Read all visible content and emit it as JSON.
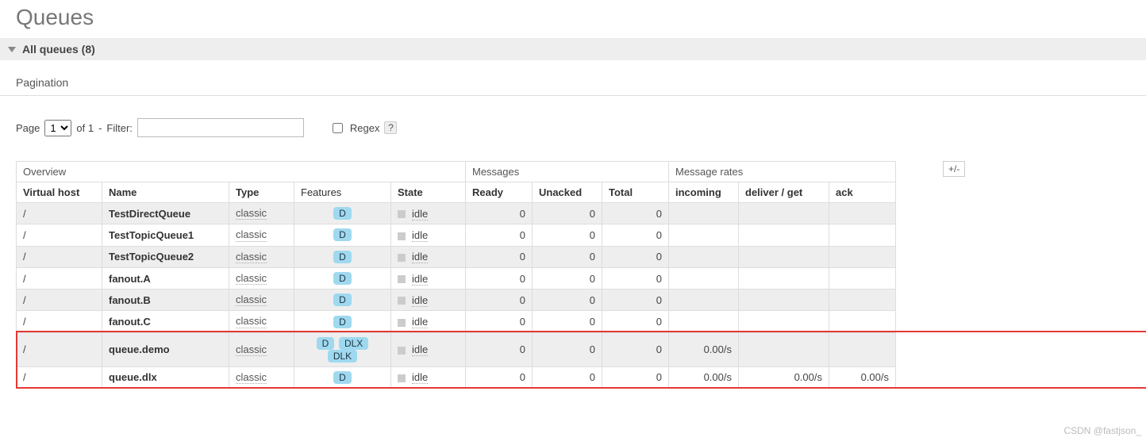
{
  "page_title": "Queues",
  "section_title": "All queues (8)",
  "pagination_label": "Pagination",
  "pager": {
    "page_label": "Page",
    "page_value": "1",
    "of_text": "of 1",
    "filter_separator": "-",
    "filter_label": "Filter:",
    "filter_value": "",
    "regex_label": "Regex",
    "help": "?"
  },
  "plusminus": "+/-",
  "groups": {
    "overview": "Overview",
    "messages": "Messages",
    "rates": "Message rates"
  },
  "columns": {
    "vhost": "Virtual host",
    "name": "Name",
    "type": "Type",
    "features": "Features",
    "state": "State",
    "ready": "Ready",
    "unacked": "Unacked",
    "total": "Total",
    "incoming": "incoming",
    "deliver_get": "deliver / get",
    "ack": "ack"
  },
  "rows": [
    {
      "vhost": "/",
      "name": "TestDirectQueue",
      "type": "classic",
      "features": [
        "D"
      ],
      "state": "idle",
      "ready": "0",
      "unacked": "0",
      "total": "0",
      "incoming": "",
      "deliver_get": "",
      "ack": ""
    },
    {
      "vhost": "/",
      "name": "TestTopicQueue1",
      "type": "classic",
      "features": [
        "D"
      ],
      "state": "idle",
      "ready": "0",
      "unacked": "0",
      "total": "0",
      "incoming": "",
      "deliver_get": "",
      "ack": ""
    },
    {
      "vhost": "/",
      "name": "TestTopicQueue2",
      "type": "classic",
      "features": [
        "D"
      ],
      "state": "idle",
      "ready": "0",
      "unacked": "0",
      "total": "0",
      "incoming": "",
      "deliver_get": "",
      "ack": ""
    },
    {
      "vhost": "/",
      "name": "fanout.A",
      "type": "classic",
      "features": [
        "D"
      ],
      "state": "idle",
      "ready": "0",
      "unacked": "0",
      "total": "0",
      "incoming": "",
      "deliver_get": "",
      "ack": ""
    },
    {
      "vhost": "/",
      "name": "fanout.B",
      "type": "classic",
      "features": [
        "D"
      ],
      "state": "idle",
      "ready": "0",
      "unacked": "0",
      "total": "0",
      "incoming": "",
      "deliver_get": "",
      "ack": ""
    },
    {
      "vhost": "/",
      "name": "fanout.C",
      "type": "classic",
      "features": [
        "D"
      ],
      "state": "idle",
      "ready": "0",
      "unacked": "0",
      "total": "0",
      "incoming": "",
      "deliver_get": "",
      "ack": ""
    },
    {
      "vhost": "/",
      "name": "queue.demo",
      "type": "classic",
      "features": [
        "D",
        "DLX",
        "DLK"
      ],
      "state": "idle",
      "ready": "0",
      "unacked": "0",
      "total": "0",
      "incoming": "0.00/s",
      "deliver_get": "",
      "ack": ""
    },
    {
      "vhost": "/",
      "name": "queue.dlx",
      "type": "classic",
      "features": [
        "D"
      ],
      "state": "idle",
      "ready": "0",
      "unacked": "0",
      "total": "0",
      "incoming": "0.00/s",
      "deliver_get": "0.00/s",
      "ack": "0.00/s"
    }
  ],
  "watermark": "CSDN @fastjson_"
}
